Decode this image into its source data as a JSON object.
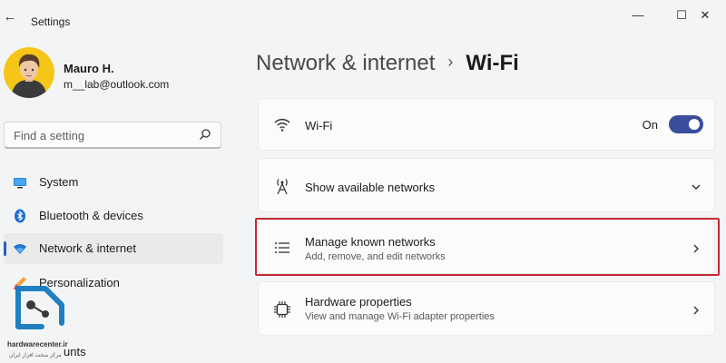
{
  "window": {
    "title": "Settings",
    "back_glyph": "←",
    "minimize_glyph": "—",
    "maximize_glyph": "☐",
    "close_glyph": "✕"
  },
  "user": {
    "name": "Mauro H.",
    "email": "m__lab@outlook.com"
  },
  "search": {
    "placeholder": "Find a setting",
    "value": ""
  },
  "sidebar": {
    "items": [
      {
        "label": "System",
        "icon": "monitor-icon",
        "active": false
      },
      {
        "label": "Bluetooth & devices",
        "icon": "bluetooth-icon",
        "active": false
      },
      {
        "label": "Network & internet",
        "icon": "wifi-icon",
        "active": true
      },
      {
        "label": "Personalization",
        "icon": "brush-icon",
        "active": false
      }
    ],
    "cut_off_label": "unts"
  },
  "breadcrumb": {
    "parent": "Network & internet",
    "separator": "›",
    "current": "Wi-Fi"
  },
  "cards": {
    "wifi": {
      "title": "Wi-Fi",
      "toggle_label": "On",
      "toggle_on": true,
      "icon": "wifi-icon"
    },
    "available": {
      "title": "Show available networks",
      "icon": "antenna-icon"
    },
    "known": {
      "title": "Manage known networks",
      "subtitle": "Add, remove, and edit networks",
      "icon": "list-icon",
      "highlighted": true
    },
    "hardware": {
      "title": "Hardware properties",
      "subtitle": "View and manage Wi-Fi adapter properties",
      "icon": "chip-icon"
    }
  },
  "watermark": {
    "text": "hardwarecenter.ir",
    "subtext": "مرکز سخت افزار ایران"
  },
  "colors": {
    "accent": "#3a4f9c",
    "nav_indicator": "#2b5fb4",
    "highlight_border": "#c62a36",
    "logo_blue": "#1f7fc0"
  }
}
